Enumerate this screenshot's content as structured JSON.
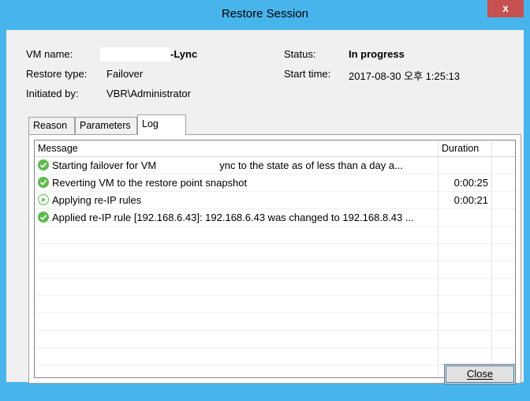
{
  "window": {
    "title": "Restore Session",
    "close_glyph": "x"
  },
  "info": {
    "vm_name_label": "VM name:",
    "vm_name_value": "-Lync",
    "restore_type_label": "Restore type:",
    "restore_type_value": "Failover",
    "initiated_by_label": "Initiated by:",
    "initiated_by_value": "VBR\\Administrator",
    "status_label": "Status:",
    "status_value": "In progress",
    "start_time_label": "Start time:",
    "start_time_value": "2017-08-30 오후 1:25:13"
  },
  "tabs": [
    {
      "label": "Reason"
    },
    {
      "label": "Parameters"
    },
    {
      "label": "Log"
    }
  ],
  "log": {
    "columns": {
      "message": "Message",
      "duration": "Duration"
    },
    "rows": [
      {
        "icon": "success-check-icon",
        "message_start": "Starting failover for VM",
        "message_end": "ync to the state as of less than a day a...",
        "duration": ""
      },
      {
        "icon": "success-check-icon",
        "message": "Reverting VM to the restore point snapshot",
        "duration": "0:00:25"
      },
      {
        "icon": "in-progress-play-icon",
        "message": "Applying re-IP rules",
        "duration": "0:00:21"
      },
      {
        "icon": "success-check-icon",
        "message": "Applied re-IP rule [192.168.6.43]: 192.168.6.43 was changed to 192.168.8.43 ...",
        "duration": ""
      }
    ]
  },
  "buttons": {
    "close": "Close"
  },
  "colors": {
    "accent": "#48b4ec",
    "close_button": "#c75050",
    "success": "#5fb94f"
  }
}
